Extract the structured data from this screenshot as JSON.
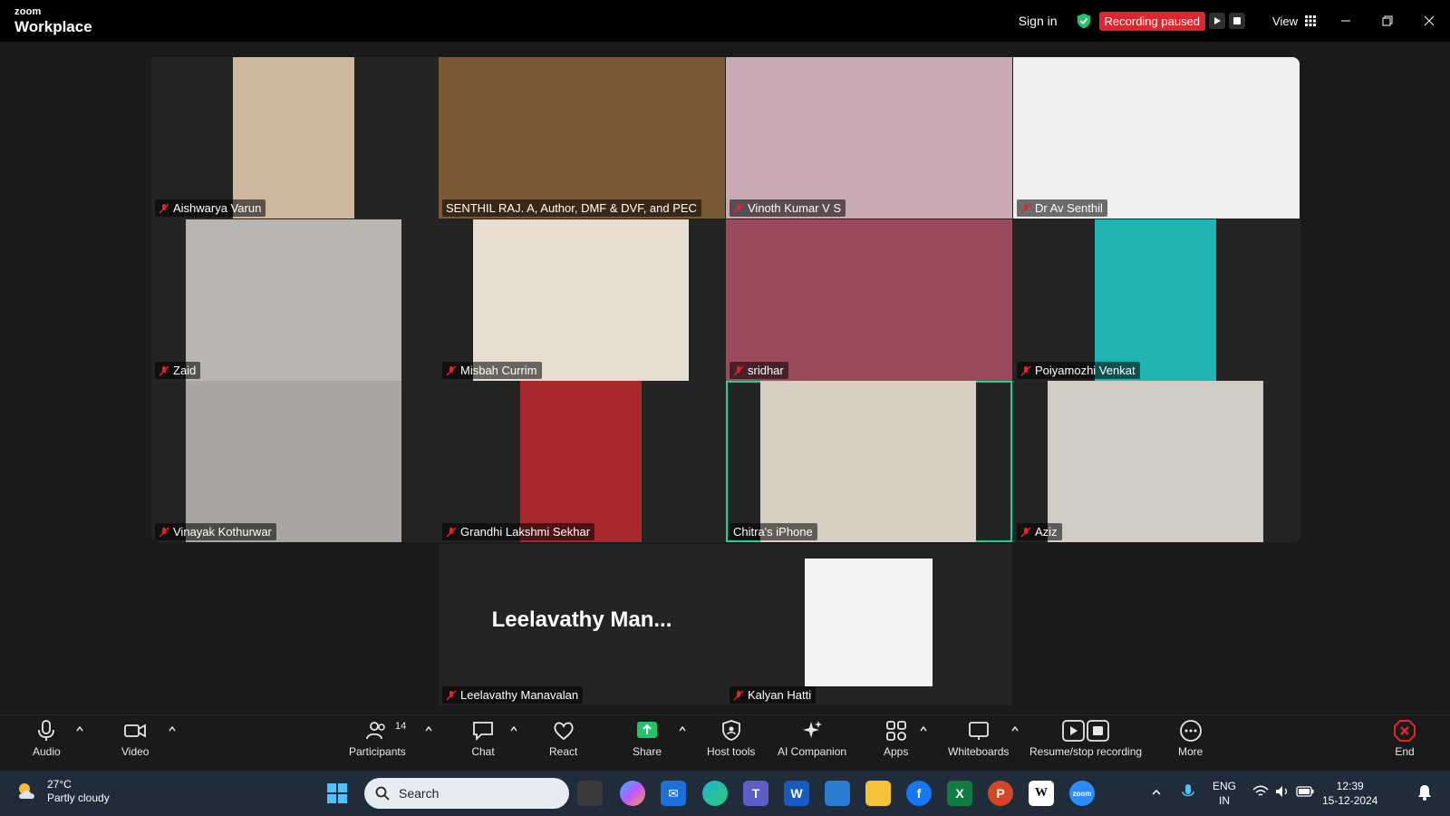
{
  "app": {
    "brand_small": "zoom",
    "brand_large": "Workplace"
  },
  "titlebar": {
    "sign_in": "Sign in",
    "recording_status": "Recording paused",
    "view_label": "View"
  },
  "participants": [
    {
      "name": "Aishwarya Varun",
      "muted": true,
      "video_color": "#cdb89e"
    },
    {
      "name": "SENTHIL RAJ. A, Author, DMF & DVF, and PEC",
      "muted": false,
      "video_color": "#7a5a34"
    },
    {
      "name": "Vinoth Kumar V S",
      "muted": true,
      "video_color": "#c9a9b4"
    },
    {
      "name": "Dr Av Senthil",
      "muted": true,
      "video_color": "#f1eeee"
    },
    {
      "name": "Zaid",
      "muted": true,
      "video_color": "#b9b6b2"
    },
    {
      "name": "Misbah Currim",
      "muted": true,
      "video_color": "#e7ddd0"
    },
    {
      "name": "sridhar",
      "muted": true,
      "video_color": "#9a4b5a"
    },
    {
      "name": "Poiyamozhi Venkat",
      "muted": true,
      "video_color": "#1fb5b2"
    },
    {
      "name": "Vinayak Kothurwar",
      "muted": true,
      "video_color": "#a9a6a2"
    },
    {
      "name": "Grandhi Lakshmi Sekhar",
      "muted": true,
      "video_color": "#a82a2e"
    },
    {
      "name": "Chitra's iPhone",
      "muted": false,
      "video_color": "#d8cfc2"
    },
    {
      "name": "Aziz",
      "muted": true,
      "video_color": "#d2cdc4"
    },
    {
      "name": "Leelavathy Manavalan",
      "muted": true,
      "display_name": "Leelavathy  Man..."
    },
    {
      "name": "Kalyan Hatti",
      "muted": true,
      "video_color": "#f4f4f4"
    }
  ],
  "toolbar": {
    "audio": "Audio",
    "video": "Video",
    "participants": "Participants",
    "participants_count": "14",
    "chat": "Chat",
    "react": "React",
    "share": "Share",
    "host_tools": "Host tools",
    "ai_companion": "AI Companion",
    "apps": "Apps",
    "whiteboards": "Whiteboards",
    "recording": "Resume/stop recording",
    "more": "More",
    "end": "End"
  },
  "taskbar": {
    "temperature": "27°C",
    "weather": "Partly cloudy",
    "search_placeholder": "Search",
    "language": "ENG",
    "region": "IN",
    "time": "12:39",
    "date": "15-12-2024"
  },
  "colors": {
    "recording_red": "#e0262d",
    "active_speaker_green": "#23d18b",
    "share_green": "#23c26b"
  }
}
